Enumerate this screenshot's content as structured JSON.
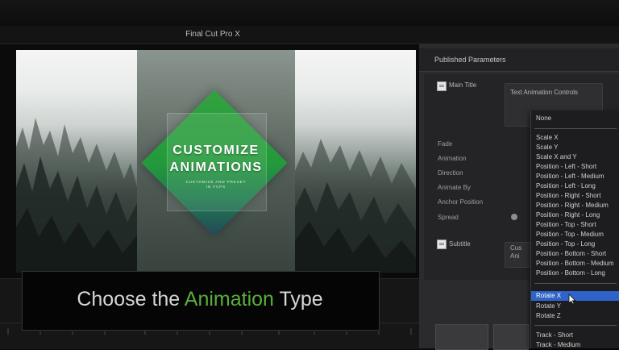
{
  "app": {
    "title": "Final Cut Pro X"
  },
  "viewer": {
    "title_line": "CUSTOMIZE\nANIMATIONS",
    "tagline": "CUSTOMIZE AND PRESET\nIN FCPX"
  },
  "inspector": {
    "header": "Published Parameters",
    "main_title": "Main Title",
    "popup_label": "Text Animation Controls",
    "params": [
      "Fade",
      "Animation",
      "Direction",
      "Animate By",
      "Anchor Position",
      "Spread"
    ],
    "subtitle": "Subtitle",
    "clipped_text": "Cus\nAni"
  },
  "menu": {
    "items_top": [
      "None"
    ],
    "items_main": [
      "Scale X",
      "Scale Y",
      "Scale X and Y",
      "Position - Left - Short",
      "Position - Left - Medium",
      "Position - Left - Long",
      "Position - Right - Short",
      "Position - Right - Medium",
      "Position - Right - Long",
      "Position - Top - Short",
      "Position - Top - Medium",
      "Position - Top - Long",
      "Position - Bottom - Short",
      "Position - Bottom - Medium",
      "Position - Bottom - Long"
    ],
    "items_rotate": [
      "Rotate X",
      "Rotate Y",
      "Rotate Z"
    ],
    "items_track": [
      "Track - Short",
      "Track - Medium"
    ],
    "selected": "Rotate X"
  },
  "banner": {
    "pre": "Choose the ",
    "highlight": "Animation",
    "post": " Type",
    "highlight_color": "#5aae3c"
  },
  "icons": {
    "section": "text-section-icon",
    "cursor": "mouse-pointer-icon"
  }
}
